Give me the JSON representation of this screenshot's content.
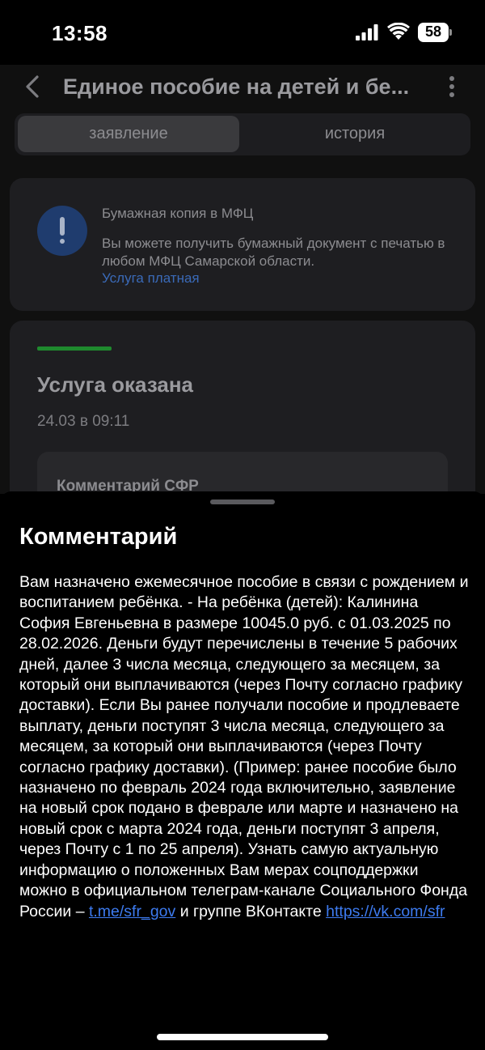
{
  "status_bar": {
    "time": "13:58",
    "battery_level": "58"
  },
  "header": {
    "title": "Единое пособие на детей и бе..."
  },
  "tabs": [
    {
      "label": "заявление",
      "active": true
    },
    {
      "label": "история",
      "active": false
    }
  ],
  "notice": {
    "title": "Бумажная копия в МФЦ",
    "text": "Вы можете получить бумажный документ с печатью в любом МФЦ Самарской области.",
    "link": "Услуга платная",
    "icon": "exclamation-icon"
  },
  "status_card": {
    "title": "Услуга оказана",
    "date": "24.03 в 09:11",
    "comment_title": "Комментарий СФР",
    "progress_color": "#1f8a2e"
  },
  "sheet": {
    "title": "Комментарий",
    "body": "Вам назначено ежемесячное пособие в связи с рождением и воспитанием ребёнка. - На ребёнка (детей): Калинина София Евгеньевна в размере 10045.0 руб. с 01.03.2025 по 28.02.2026. Деньги будут перечислены в течение 5 рабочих дней, далее 3 числа месяца, следующего за месяцем, за который они выплачиваются (через Почту согласно графику доставки). Если Вы ранее получали пособие и продлеваете выплату, деньги поступят 3 числа месяца, следующего за месяцем, за который они выплачиваются (через Почту согласно графику доставки). (Пример: ранее пособие было назначено по февраль 2024 года включительно, заявление на новый срок подано в феврале или марте и назначено на новый срок с марта 2024 года, деньги поступят 3 апреля, через Почту с 1 по 25 апреля). Узнать самую актуальную информацию о положенных Вам мерах соцподдержки можно в официальном телеграм-канале Социального Фонда России –",
    "link_telegram": "t.me/sfr_gov",
    "middle_text": "и группе ВКонтакте",
    "link_vk": "https://vk.com/sfr",
    "link_color": "#3d7bf0"
  }
}
